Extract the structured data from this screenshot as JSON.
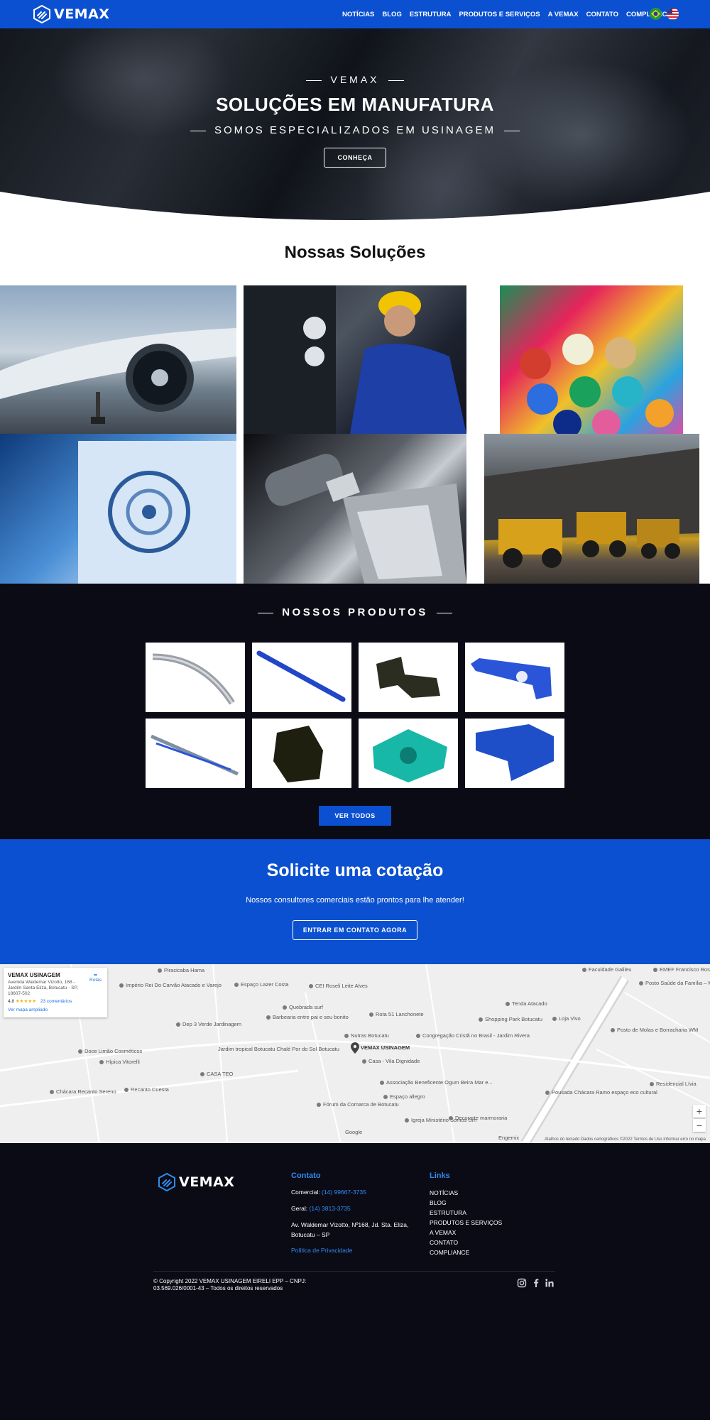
{
  "brand": "VEMAX",
  "nav": {
    "items": [
      "NOTÍCIAS",
      "BLOG",
      "ESTRUTURA",
      "PRODUTOS E SERVIÇOS",
      "A VEMAX",
      "CONTATO",
      "COMPLIANCE"
    ],
    "languages": [
      "br-flag-icon",
      "us-flag-icon"
    ]
  },
  "hero": {
    "brand": "VEMAX",
    "title": "SOLUÇÕES EM MANUFATURA",
    "subtitle": "SOMOS ESPECIALIZADOS EM USINAGEM",
    "button": "CONHEÇA"
  },
  "solutions": {
    "title": "Nossas Soluções",
    "tiles": [
      "aviation-image",
      "technician-image",
      "plastics-image",
      "engineering-screen-image",
      "machining-image",
      "mining-image"
    ]
  },
  "products": {
    "title": "NOSSOS PRODUTOS",
    "items": [
      "curved-rail-part",
      "blue-bar-part",
      "black-bracket-part",
      "blue-arm-part",
      "rail-assembly-part",
      "black-block-part",
      "teal-housing-part",
      "blue-plate-part"
    ],
    "button": "VER TODOS"
  },
  "quote": {
    "title": "Solicite uma cotação",
    "text": "Nossos consultores comerciais estão prontos para lhe atender!",
    "button": "ENTRAR EM CONTATO AGORA"
  },
  "map": {
    "card": {
      "name": "VEMAX USINAGEM",
      "address": "Avenida Waldemar Vizotto, 168 - Jardim Santa Eliza, Botucatu - SP, 18607-502",
      "rating": "4,8",
      "stars": "★★★★★",
      "reviews": "23 comentários",
      "larger_map": "Ver mapa ampliado",
      "routes": "Rotas"
    },
    "pin_label": "VEMAX USINAGEM",
    "labels": [
      "Piracicaba Hama",
      "Império Rei Do Carvão Atacado e Varejo",
      "Espaço Lazer Costa",
      "CEI Roseli Leite Alves",
      "Quebrada surf",
      "Barbearia entre pai e seu bonito",
      "Rota 51 Lanchonete",
      "Dep 3 Verde Jardinagem",
      "Nutras Botucatu",
      "Congregação Cristã no Brasil - Jardim Rivera",
      "Doce Limão Cosméticos",
      "Hípica Vitorelli",
      "Jardim tropical Botucatu Chalé Por do Sol Botucatu",
      "CASA TEO",
      "Casa - Vila Dignidade",
      "Recanto Cuesta",
      "Chácara Recanto Sereno",
      "Associação Beneficente Ogum Beira Mar e...",
      "Espaço allegro",
      "Fórum da Comarca de Botucatu",
      "Igreja Ministério Somos Um",
      "Decorarte marmoraria",
      "Tenda Atacado",
      "Shopping Park Botucatu",
      "Loja Vivo",
      "Posto de Molas e Borracharia WM",
      "Pousada Chácara Ramo espaço eco cultural",
      "Residencial Lívia",
      "Faculdade Galileu",
      "Posto Saúde da Família – Marajoara",
      "EMEF Francisco Rosa",
      "Engemix",
      "Google"
    ],
    "footer": "Atalhos do teclado   Dados cartográficos ©2022   Termos de Uso   Informar erro no mapa"
  },
  "footer": {
    "contact_title": "Contato",
    "commercial_label": "Comercial:",
    "commercial_phone": "(14) 99667-3735",
    "general_label": "Geral:",
    "general_phone": "(14) 3813-3735",
    "address_line1": "Av. Waldemar Vizotto, Nº168, Jd. Sta. Eliza,",
    "address_line2": "Botucatu – SP",
    "privacy": "Política de Privacidade",
    "links_title": "Links",
    "links": [
      "NOTÍCIAS",
      "BLOG",
      "ESTRUTURA",
      "PRODUTOS E SERVIÇOS",
      "A VEMAX",
      "CONTATO",
      "COMPLIANCE"
    ],
    "copyright_line1": "© Copyright 2022 VEMAX USINAGEM EIRELI EPP – CNPJ:",
    "copyright_line2": "03.569.026/0001-43 – Todos os direitos reservados",
    "social": [
      "instagram-icon",
      "facebook-icon",
      "linkedin-icon"
    ]
  },
  "colors": {
    "primary_blue": "#0b50d0",
    "dark_bg": "#0b0b16",
    "link_blue": "#2e8cf0"
  }
}
